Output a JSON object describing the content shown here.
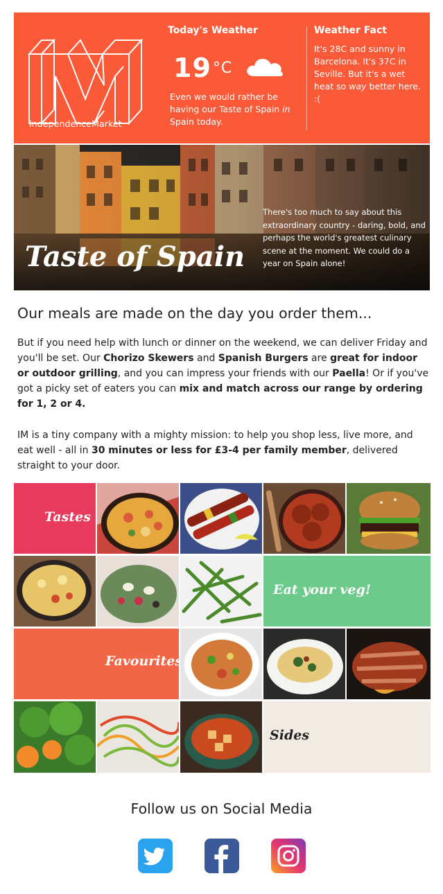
{
  "header": {
    "brand": "IndependenceMarket",
    "weather_title": "Today's Weather",
    "temperature": "19",
    "temperature_unit": "°C",
    "weather_desc_pre": "Even we would rather be having our Taste of Spain ",
    "weather_desc_em": "in",
    "weather_desc_post": " Spain today.",
    "fact_title": "Weather Fact",
    "fact_pre": "It's 28C and sunny in Barcelona. It's 37C in Seville. But it's a wet heat so ",
    "fact_em": "way",
    "fact_post": " better here. :(",
    "colors": {
      "accent": "#fb5a38"
    }
  },
  "banner": {
    "title": "Taste of Spain",
    "text": "There's too much to say about this extraordinary country - daring, bold, and perhaps the world's greatest culinary scene at the moment. We could do a year on Spain alone!"
  },
  "main": {
    "headline": "Our meals are made on the day you order them...",
    "p1": {
      "a": "But if you need help with lunch or dinner on the weekend, we can deliver Friday and you'll be set. Our ",
      "b1": "Chorizo Skewers",
      "c": " and ",
      "b2": "Spanish Burgers",
      "d": " are ",
      "b3": "great for indoor or outdoor grilling",
      "e": ", and you can impress your friends with our ",
      "b4": "Paella",
      "f": "! Or if you've got a picky set of eaters you can ",
      "b5": "mix and match across our range by ordering for 1, 2 or 4."
    },
    "p2": {
      "a": "IM is a tiny company with a mighty mission: to help you shop less, live more, and eat well - all in ",
      "b1": "30 minutes or less for £3-4 per family member",
      "c": ", delivered straight to your door."
    }
  },
  "grid": {
    "tastes": "Tastes",
    "veg": "Eat your veg!",
    "favourites": "Favourites",
    "sides": "Sides",
    "colors": {
      "tastes": "#e83a5c",
      "veg": "#6ccb8b",
      "favourites": "#f06646",
      "sides": "#f2ebe4"
    }
  },
  "social": {
    "title": "Follow us on Social Media",
    "icons": [
      "twitter-icon",
      "facebook-icon",
      "instagram-icon"
    ]
  }
}
